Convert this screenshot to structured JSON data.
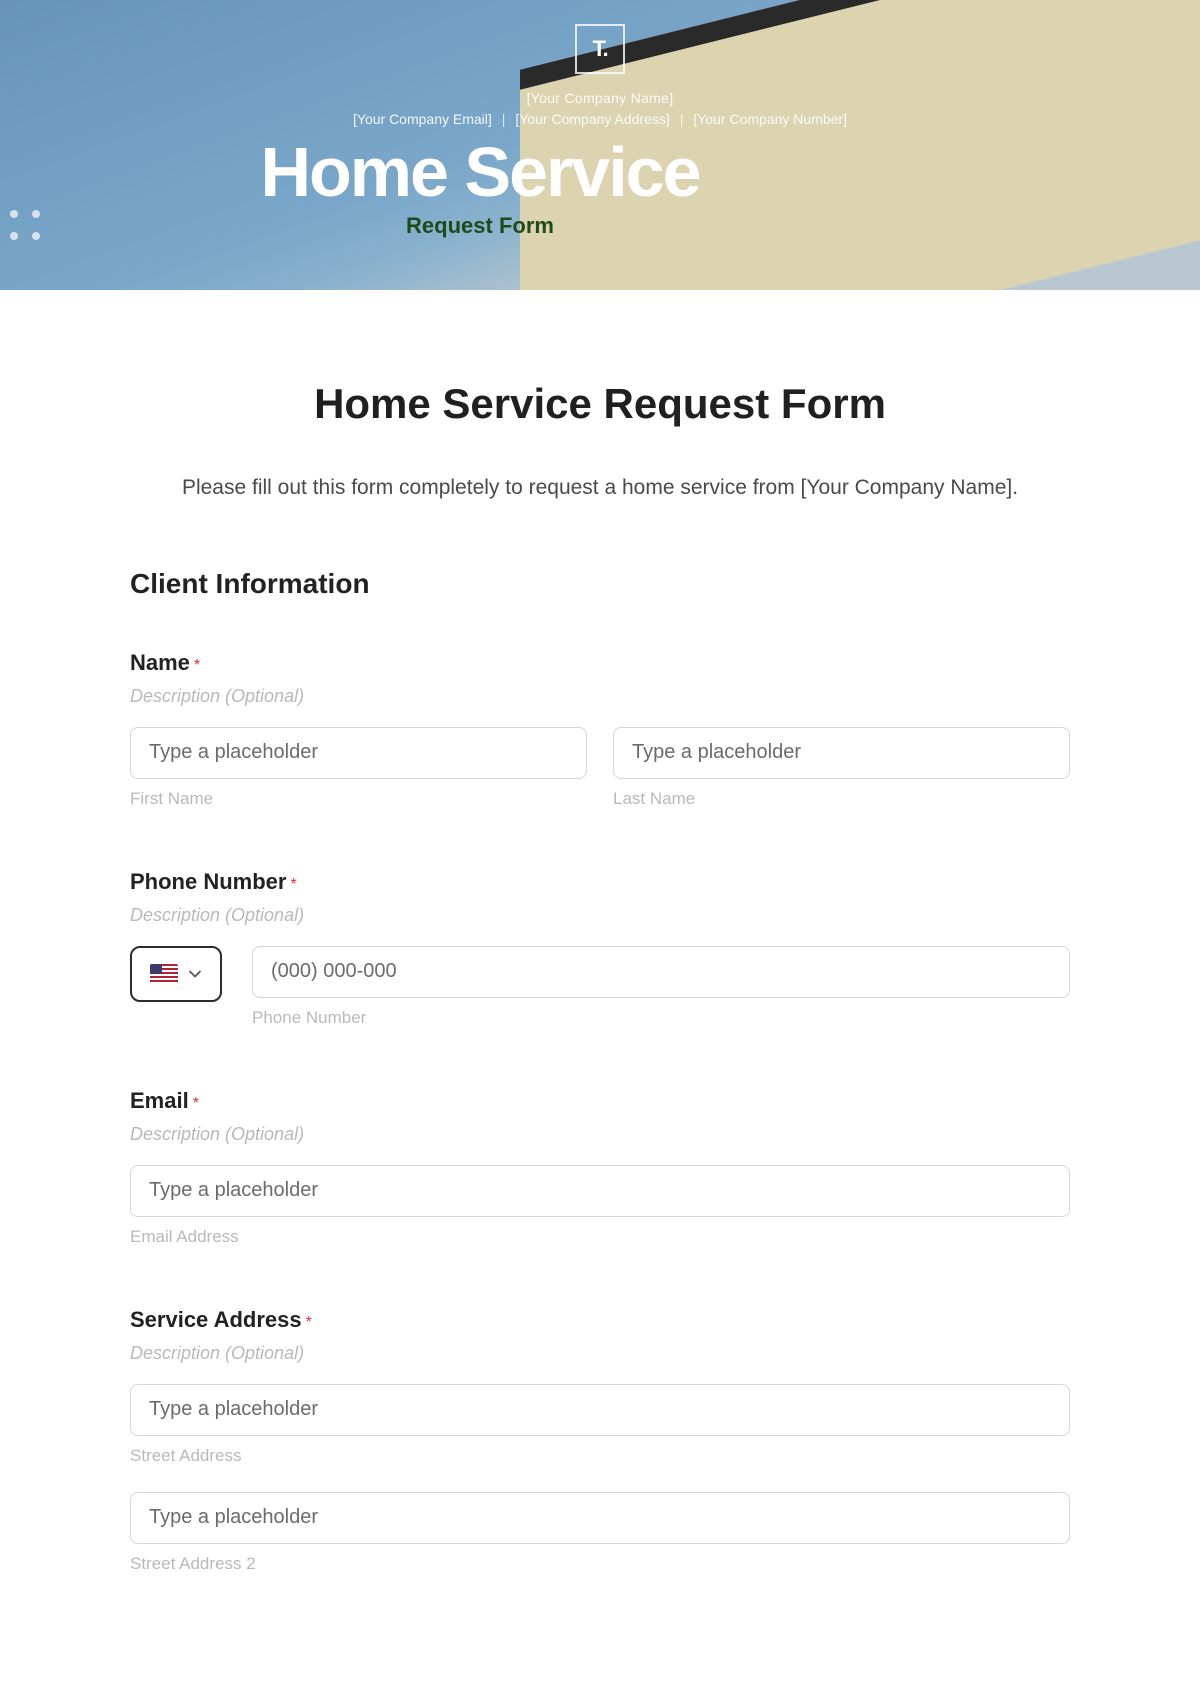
{
  "hero": {
    "logo_text": "T.",
    "company_name": "[Your Company Name]",
    "company_email": "[Your Company Email]",
    "company_address": "[Your Company Address]",
    "company_number": "[Your Company Number]",
    "title": "Home Service",
    "subtitle": "Request Form"
  },
  "content": {
    "page_title": "Home Service Request Form",
    "page_intro": "Please fill out this form completely to request a home service from [Your Company Name].",
    "section_client_info": "Client Information"
  },
  "fields": {
    "name": {
      "label": "Name",
      "desc": "Description (Optional)",
      "first_placeholder": "Type a placeholder",
      "first_sub": "First Name",
      "last_placeholder": "Type a placeholder",
      "last_sub": "Last Name"
    },
    "phone": {
      "label": "Phone Number",
      "desc": "Description (Optional)",
      "placeholder": "(000) 000-000",
      "sub": "Phone Number"
    },
    "email": {
      "label": "Email",
      "desc": "Description (Optional)",
      "placeholder": "Type a placeholder",
      "sub": "Email Address"
    },
    "address": {
      "label": "Service Address",
      "desc": "Description (Optional)",
      "street1_placeholder": "Type a placeholder",
      "street1_sub": "Street Address",
      "street2_placeholder": "Type a placeholder",
      "street2_sub": "Street Address 2"
    }
  }
}
